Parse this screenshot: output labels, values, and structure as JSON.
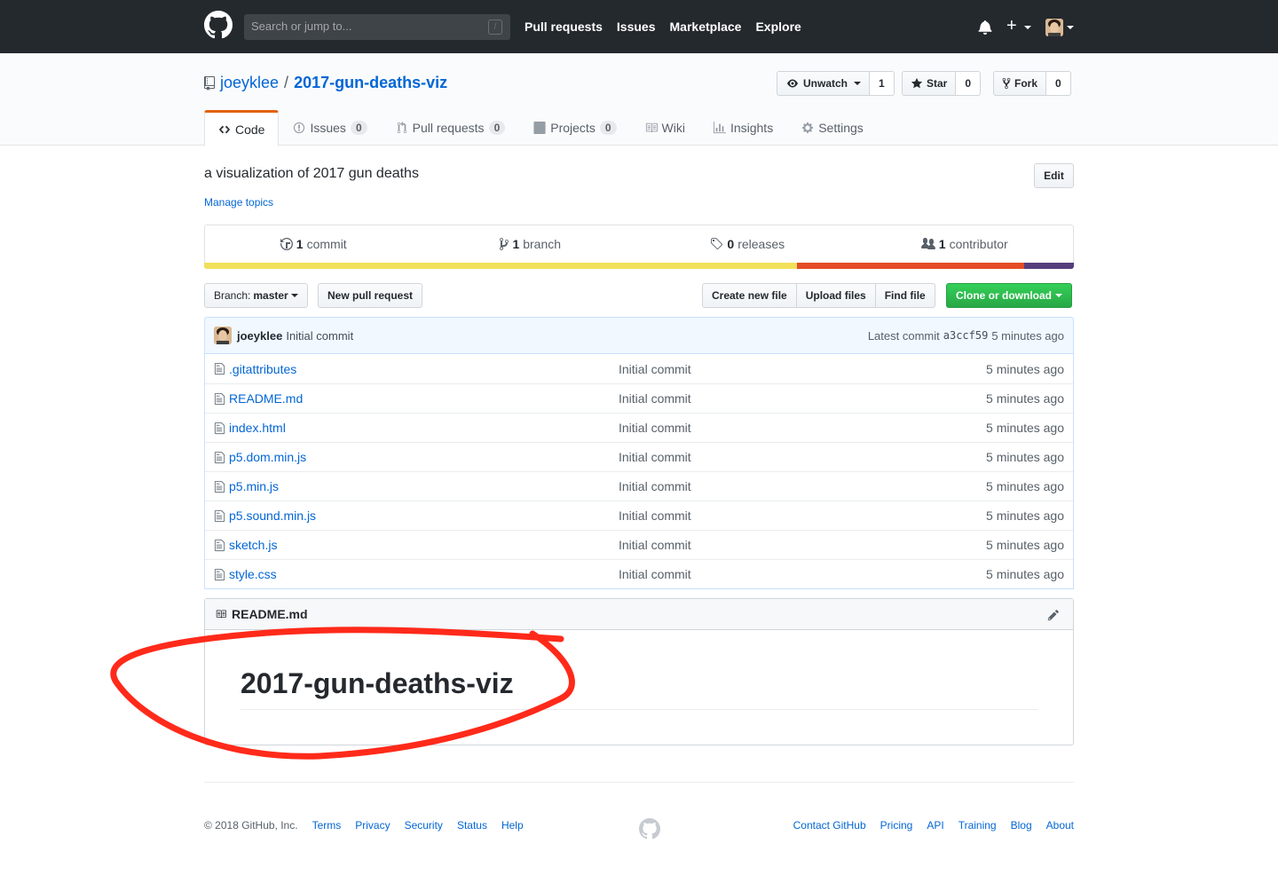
{
  "header": {
    "search_placeholder": "Search or jump to...",
    "search_key": "/",
    "nav": [
      "Pull requests",
      "Issues",
      "Marketplace",
      "Explore"
    ],
    "plus": "+"
  },
  "repo": {
    "owner": "joeyklee",
    "separator": "/",
    "name": "2017-gun-deaths-viz",
    "watch_label": "Unwatch",
    "watch_count": "1",
    "star_label": "Star",
    "star_count": "0",
    "fork_label": "Fork",
    "fork_count": "0"
  },
  "tabs": [
    {
      "label": "Code",
      "count": ""
    },
    {
      "label": "Issues",
      "count": "0"
    },
    {
      "label": "Pull requests",
      "count": "0"
    },
    {
      "label": "Projects",
      "count": "0"
    },
    {
      "label": "Wiki",
      "count": ""
    },
    {
      "label": "Insights",
      "count": ""
    },
    {
      "label": "Settings",
      "count": ""
    }
  ],
  "description": "a visualization of 2017 gun deaths",
  "manage_topics": "Manage topics",
  "edit_label": "Edit",
  "summary": {
    "commits_num": "1",
    "commits_label": "commit",
    "branches_num": "1",
    "branches_label": "branch",
    "releases_num": "0",
    "releases_label": "releases",
    "contributors_num": "1",
    "contributors_label": "contributor"
  },
  "languages": [
    {
      "color": "#f1e05a",
      "fraction": 0.682
    },
    {
      "color": "#e34c26",
      "fraction": 0.261
    },
    {
      "color": "#563d7c",
      "fraction": 0.057
    }
  ],
  "file_nav": {
    "branch_prefix": "Branch:",
    "branch": "master",
    "new_pr": "New pull request",
    "create_file": "Create new file",
    "upload_files": "Upload files",
    "find_file": "Find file",
    "clone": "Clone or download"
  },
  "commit_tease": {
    "author": "joeyklee",
    "message": "Initial commit",
    "latest_label": "Latest commit",
    "sha": "a3ccf59",
    "age": "5 minutes ago"
  },
  "files": [
    {
      "name": ".gitattributes",
      "message": "Initial commit",
      "age": "5 minutes ago"
    },
    {
      "name": "README.md",
      "message": "Initial commit",
      "age": "5 minutes ago"
    },
    {
      "name": "index.html",
      "message": "Initial commit",
      "age": "5 minutes ago"
    },
    {
      "name": "p5.dom.min.js",
      "message": "Initial commit",
      "age": "5 minutes ago"
    },
    {
      "name": "p5.min.js",
      "message": "Initial commit",
      "age": "5 minutes ago"
    },
    {
      "name": "p5.sound.min.js",
      "message": "Initial commit",
      "age": "5 minutes ago"
    },
    {
      "name": "sketch.js",
      "message": "Initial commit",
      "age": "5 minutes ago"
    },
    {
      "name": "style.css",
      "message": "Initial commit",
      "age": "5 minutes ago"
    }
  ],
  "readme": {
    "filename": "README.md",
    "heading": "2017-gun-deaths-viz"
  },
  "annotation_color": "#ff2a1a",
  "footer": {
    "copyright": "© 2018 GitHub, Inc.",
    "left_links": [
      "Terms",
      "Privacy",
      "Security",
      "Status",
      "Help"
    ],
    "right_links": [
      "Contact GitHub",
      "Pricing",
      "API",
      "Training",
      "Blog",
      "About"
    ]
  }
}
